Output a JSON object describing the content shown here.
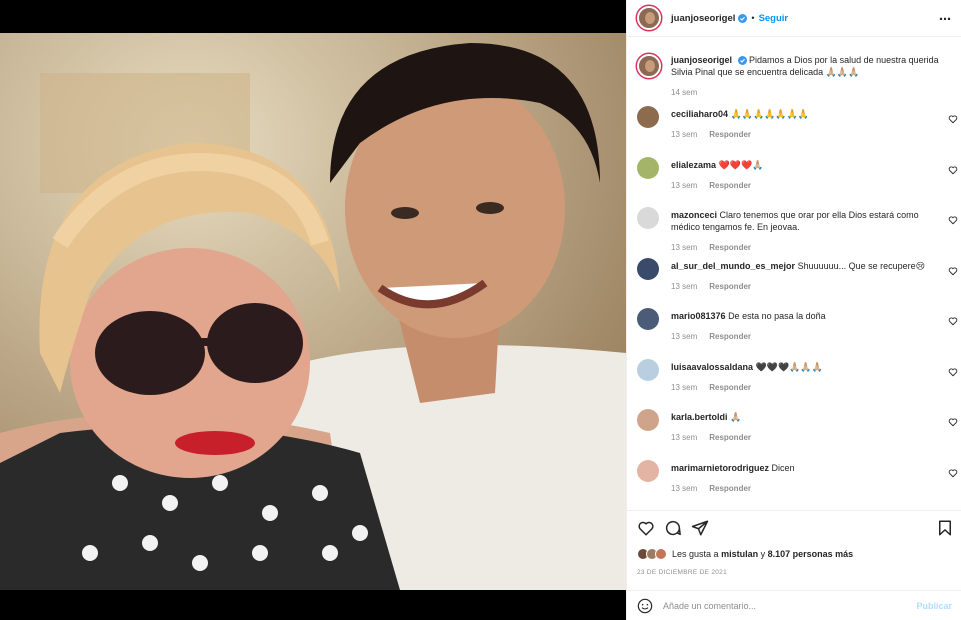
{
  "post": {
    "author": "juanjoseorigel",
    "follow_label": "Seguir",
    "dot": "•",
    "more_icon": "⋯",
    "caption_text": "Pidamos a Dios por la salud de nuestra querida Silvia Pinal que se encuentra delicada 🙏🏼🙏🏼🙏🏼",
    "caption_time": "14 sem",
    "likes_prefix": "Les gusta a",
    "likes_user": "mistulan",
    "likes_and": "y",
    "likes_count": "8.107 personas más",
    "date": "23 DE DICIEMBRE DE 2021",
    "comment_placeholder": "Añade un comentario...",
    "publish_label": "Publicar"
  },
  "comments": [
    {
      "user": "ceciliaharo04",
      "text": "🙏🙏🙏🙏🙏🙏🙏",
      "time": "13 sem",
      "reply": "Responder"
    },
    {
      "user": "elialezama",
      "text": "❤️❤️❤️🙏🏼",
      "time": "13 sem",
      "reply": "Responder"
    },
    {
      "user": "mazonceci",
      "text": "Claro tenemos que orar por ella Dios estará como médico tengamos fe. En jeovaa.",
      "time": "13 sem",
      "reply": "Responder"
    },
    {
      "user": "al_sur_del_mundo_es_mejor",
      "text": "Shuuuuuu... Que se recupere😢",
      "time": "13 sem",
      "reply": "Responder"
    },
    {
      "user": "mario081376",
      "text": "De esta no pasa la doña",
      "time": "13 sem",
      "reply": "Responder"
    },
    {
      "user": "luisaavalossaldana",
      "text": "🖤🖤🖤🙏🏼🙏🏼🙏🏼",
      "time": "13 sem",
      "reply": "Responder"
    },
    {
      "user": "karla.bertoldi",
      "text": "🙏🏼",
      "time": "13 sem",
      "reply": "Responder"
    },
    {
      "user": "marimarnietorodriguez",
      "text": "Dicen",
      "time": "13 sem",
      "reply": "Responder"
    }
  ],
  "colors": {
    "accent": "#0095f6",
    "publish_disabled": "#b2dffc",
    "muted": "#8e8e8e",
    "text": "#262626"
  },
  "icons": {
    "like": "heart-icon",
    "comment": "comment-icon",
    "share": "share-icon",
    "save": "bookmark-icon",
    "emoji": "emoji-icon",
    "verified": "verified-badge-icon"
  }
}
